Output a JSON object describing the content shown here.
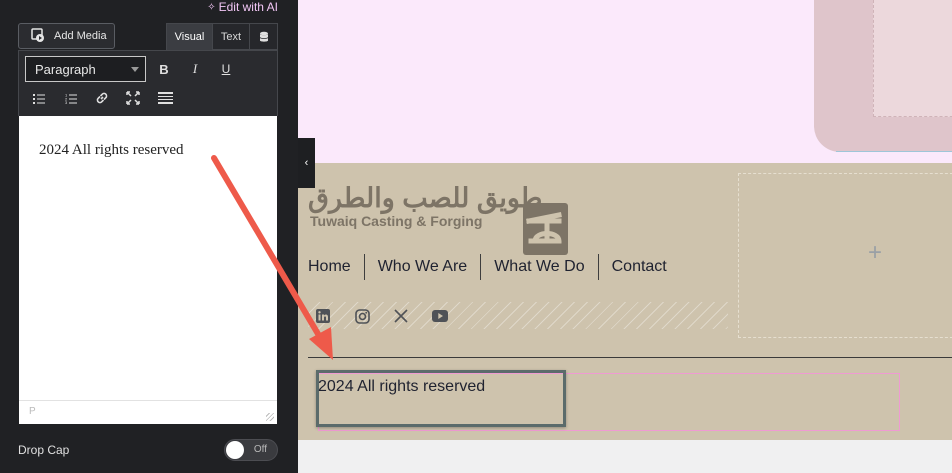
{
  "panel": {
    "edit_ai": "Edit with AI",
    "add_media": "Add Media",
    "tabs": {
      "visual": "Visual",
      "text": "Text"
    },
    "format_select": "Paragraph",
    "editor_content": "2024 All rights reserved",
    "status_path": "P",
    "drop_cap": {
      "label": "Drop Cap",
      "state": "Off"
    }
  },
  "preview": {
    "logo": {
      "arabic": "طويق للصب والطرق",
      "english": "Tuwaiq Casting & Forging"
    },
    "nav": [
      "Home",
      "Who We Are",
      "What We Do",
      "Contact"
    ],
    "social": [
      "linkedin-icon",
      "instagram-icon",
      "x-icon",
      "youtube-icon"
    ],
    "add_symbol": "+",
    "copyright": "2024 All rights reserved"
  },
  "colors": {
    "panel_bg": "#202124",
    "footer_bg": "#cec3ad",
    "pink_section": "#fbe9fb",
    "accent_pink": "#f2c6f5",
    "arrow": "#ee5a4a"
  }
}
